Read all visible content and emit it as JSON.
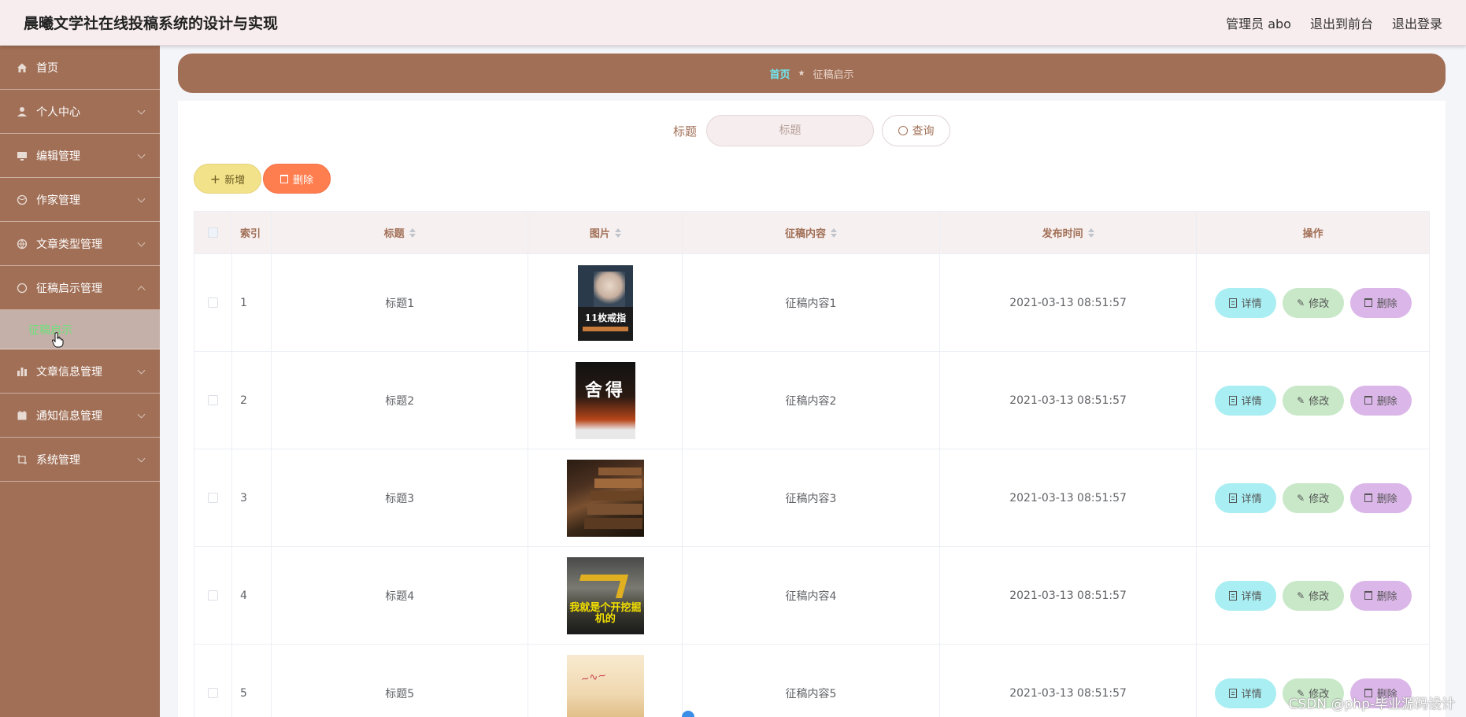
{
  "header": {
    "app_title": "晨曦文学社在线投稿系统的设计与实现",
    "admin_label": "管理员 abo",
    "to_front_label": "退出到前台",
    "logout_label": "退出登录"
  },
  "sidebar": {
    "items": [
      {
        "label": "首页",
        "icon": "home-icon"
      },
      {
        "label": "个人中心",
        "icon": "user-icon"
      },
      {
        "label": "编辑管理",
        "icon": "monitor-icon"
      },
      {
        "label": "作家管理",
        "icon": "globe-icon"
      },
      {
        "label": "文章类型管理",
        "icon": "globe-icon"
      },
      {
        "label": "征稿启示管理",
        "icon": "circle-icon"
      },
      {
        "label": "文章信息管理",
        "icon": "chart-icon"
      },
      {
        "label": "通知信息管理",
        "icon": "calendar-icon"
      },
      {
        "label": "系统管理",
        "icon": "crop-icon"
      }
    ],
    "sub_active": "征稿启示"
  },
  "breadcrumb": {
    "home": "首页",
    "current": "征稿启示"
  },
  "search": {
    "label": "标题",
    "placeholder": "标题",
    "button": "查询"
  },
  "actions": {
    "add": "新增",
    "delete": "删除"
  },
  "table": {
    "headers": {
      "index": "索引",
      "title": "标题",
      "image": "图片",
      "content": "征稿内容",
      "time": "发布时间",
      "ops": "操作"
    },
    "rows": [
      {
        "index": "1",
        "title": "标题1",
        "content": "征稿内容1",
        "time": "2021-03-13 08:51:57",
        "cover_text": "11枚戒指"
      },
      {
        "index": "2",
        "title": "标题2",
        "content": "征稿内容2",
        "time": "2021-03-13 08:51:57",
        "cover_text": "舍得"
      },
      {
        "index": "3",
        "title": "标题3",
        "content": "征稿内容3",
        "time": "2021-03-13 08:51:57",
        "cover_text": ""
      },
      {
        "index": "4",
        "title": "标题4",
        "content": "征稿内容4",
        "time": "2021-03-13 08:51:57",
        "cover_text": "我就是个开挖掘机的"
      },
      {
        "index": "5",
        "title": "标题5",
        "content": "征稿内容5",
        "time": "2021-03-13 08:51:57",
        "cover_text": ""
      }
    ],
    "ops": {
      "detail": "详情",
      "edit": "修改",
      "delete": "删除"
    }
  },
  "watermark": "CSDN @php-毕业源码设计",
  "colors": {
    "sidebar": "#a16f56",
    "header": "#f7ecee",
    "detail_btn": "#a9eef2",
    "edit_btn": "#c8e8c8",
    "delete_btn": "#dbb6e8",
    "add_btn": "#f2e28a",
    "batch_delete_btn": "#ff7e50"
  }
}
